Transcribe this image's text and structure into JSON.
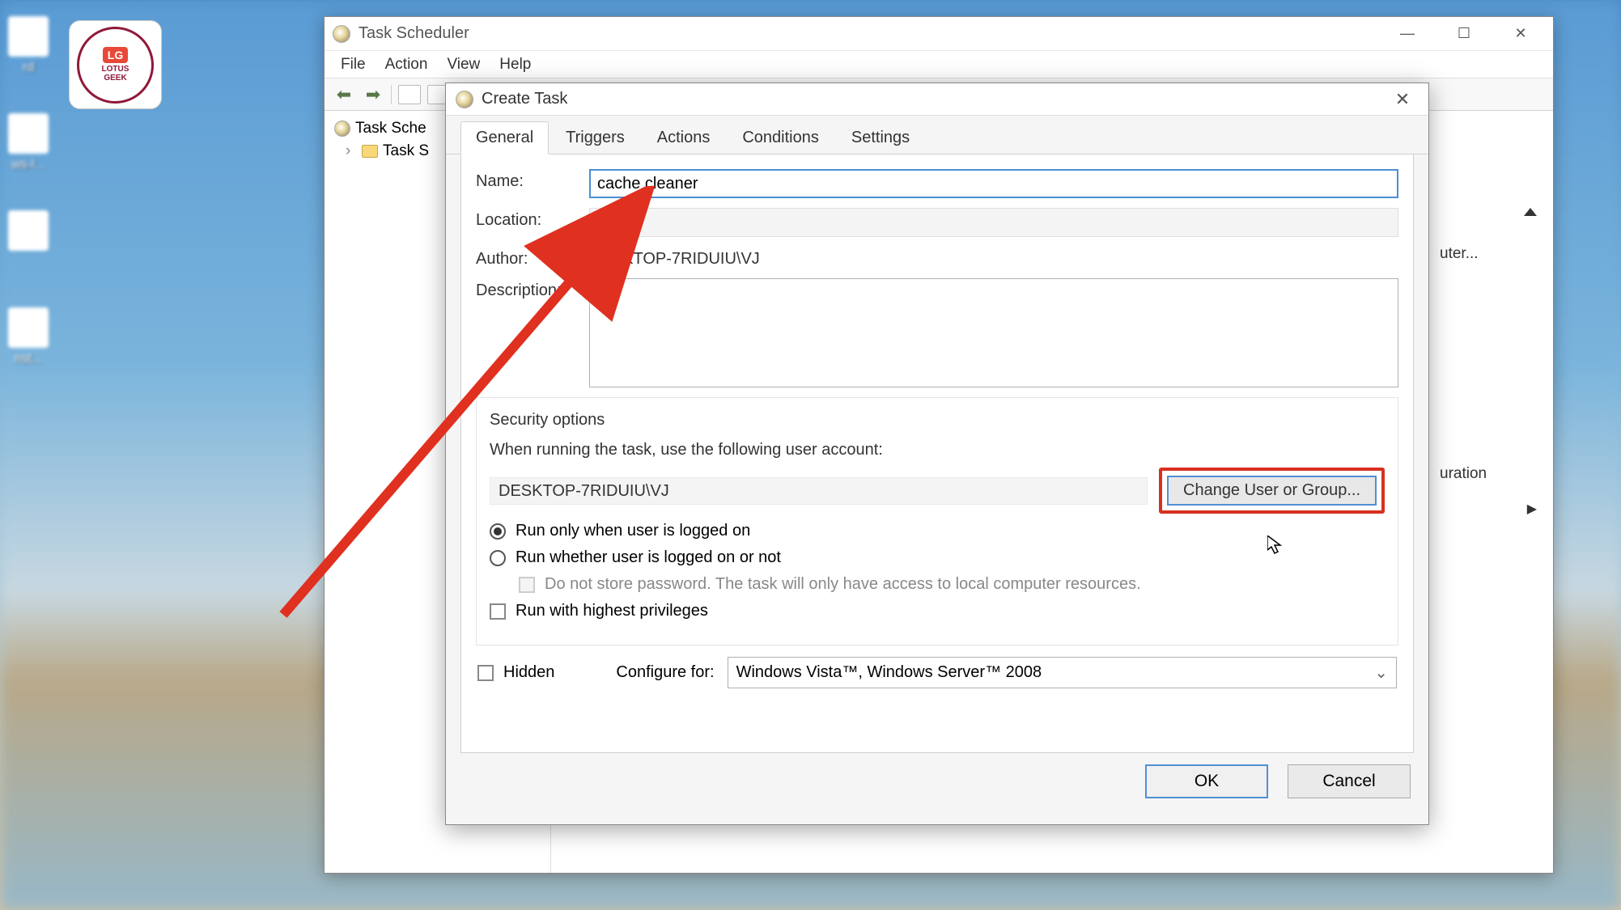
{
  "desktop": {
    "watermark_text1": "LOTUS",
    "watermark_text2": "GEEK",
    "watermark_lg": "LG",
    "icons": [
      "rd",
      "ws-l...",
      "",
      "nst..."
    ]
  },
  "parent_window": {
    "title": "Task Scheduler",
    "menus": [
      "File",
      "Action",
      "View",
      "Help"
    ],
    "tree": {
      "root": "Task Sche",
      "child": "Task S"
    },
    "right_side": {
      "text1": "uter...",
      "text2": "uration"
    }
  },
  "dialog": {
    "title": "Create Task",
    "tabs": [
      "General",
      "Triggers",
      "Actions",
      "Conditions",
      "Settings"
    ],
    "fields": {
      "name_label": "Name:",
      "name_value": "cache cleaner",
      "location_label": "Location:",
      "location_value": "\\",
      "author_label": "Author:",
      "author_value": "DESKTOP-7RIDUIU\\VJ",
      "description_label": "Description:",
      "description_value": ""
    },
    "security": {
      "legend": "Security options",
      "when_running": "When running the task, use the following user account:",
      "user_account": "DESKTOP-7RIDUIU\\VJ",
      "change_button": "Change User or Group...",
      "radio_logged_on": "Run only when user is logged on",
      "radio_whether": "Run whether user is logged on or not",
      "no_password": "Do not store password.  The task will only have access to local computer resources.",
      "highest_priv": "Run with highest privileges"
    },
    "bottom": {
      "hidden_label": "Hidden",
      "configure_label": "Configure for:",
      "configure_value": "Windows Vista™, Windows Server™ 2008"
    },
    "buttons": {
      "ok": "OK",
      "cancel": "Cancel"
    }
  }
}
